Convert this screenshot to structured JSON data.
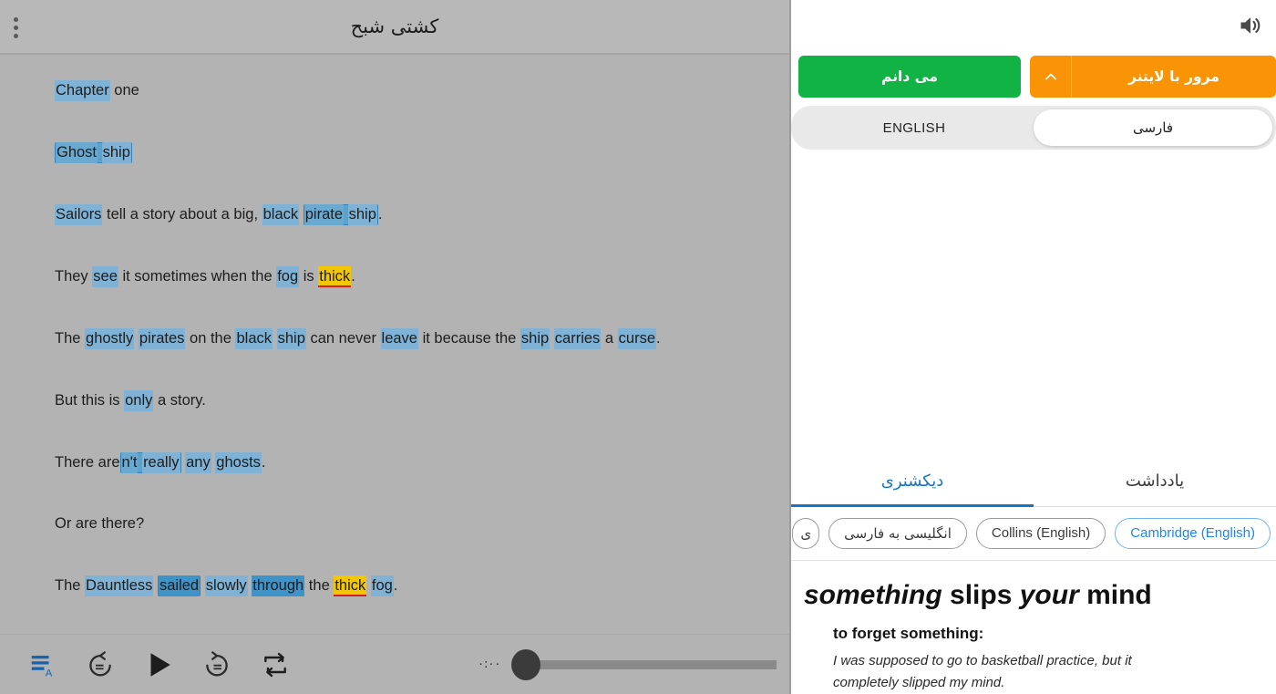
{
  "reader": {
    "menu_icon": "kebab-menu-icon",
    "title": "کشتی شبح",
    "paragraphs": [
      {
        "id": "p1",
        "tokens": [
          {
            "t": "Chapter",
            "hl": "light"
          },
          {
            "t": " one",
            "hl": "none"
          }
        ]
      },
      {
        "id": "p2",
        "tokens": [
          {
            "t": "Ghost ship",
            "hl": "phrase",
            "parts": [
              {
                "t": "Ghost",
                "hl": "mid"
              },
              {
                "t": " ",
                "hl": "none"
              },
              {
                "t": "ship",
                "hl": "light"
              }
            ]
          }
        ]
      },
      {
        "id": "p3",
        "tokens": [
          {
            "t": "Sailors",
            "hl": "light"
          },
          {
            "t": " tell a story about a big, ",
            "hl": "none"
          },
          {
            "t": "black",
            "hl": "light"
          },
          {
            "t": " ",
            "hl": "none"
          },
          {
            "t": "pirate ship",
            "hl": "phrase",
            "parts": [
              {
                "t": "pirate",
                "hl": "mid"
              },
              {
                "t": " ",
                "hl": "none"
              },
              {
                "t": "ship",
                "hl": "light"
              }
            ]
          },
          {
            "t": ".",
            "hl": "none"
          }
        ]
      },
      {
        "id": "p4",
        "tokens": [
          {
            "t": "They ",
            "hl": "none"
          },
          {
            "t": "see",
            "hl": "light"
          },
          {
            "t": " it sometimes when the ",
            "hl": "none"
          },
          {
            "t": "fog",
            "hl": "light"
          },
          {
            "t": " is ",
            "hl": "none"
          },
          {
            "t": "thick",
            "hl": "yellow"
          },
          {
            "t": ".",
            "hl": "none"
          }
        ]
      },
      {
        "id": "p5",
        "tokens": [
          {
            "t": "The ",
            "hl": "none"
          },
          {
            "t": "ghostly",
            "hl": "light"
          },
          {
            "t": " ",
            "hl": "none"
          },
          {
            "t": "pirates",
            "hl": "light"
          },
          {
            "t": " on the ",
            "hl": "none"
          },
          {
            "t": "black",
            "hl": "light"
          },
          {
            "t": " ",
            "hl": "none"
          },
          {
            "t": "ship",
            "hl": "light"
          },
          {
            "t": " can never ",
            "hl": "none"
          },
          {
            "t": "leave",
            "hl": "light"
          },
          {
            "t": " it because the ",
            "hl": "none"
          },
          {
            "t": "ship",
            "hl": "light"
          },
          {
            "t": " ",
            "hl": "none"
          },
          {
            "t": "carries",
            "hl": "light"
          },
          {
            "t": " a ",
            "hl": "none"
          },
          {
            "t": "curse",
            "hl": "light"
          },
          {
            "t": ".",
            "hl": "none"
          }
        ]
      },
      {
        "id": "p6",
        "tokens": [
          {
            "t": "But this is ",
            "hl": "none"
          },
          {
            "t": "only",
            "hl": "light"
          },
          {
            "t": " a story.",
            "hl": "none"
          }
        ]
      },
      {
        "id": "p7",
        "tokens": [
          {
            "t": "There are",
            "hl": "none"
          },
          {
            "t": "n't really",
            "hl": "phrase",
            "parts": [
              {
                "t": "n't",
                "hl": "mid"
              },
              {
                "t": " ",
                "hl": "none"
              },
              {
                "t": "really",
                "hl": "light"
              }
            ]
          },
          {
            "t": " ",
            "hl": "none"
          },
          {
            "t": "any",
            "hl": "light"
          },
          {
            "t": " ",
            "hl": "none"
          },
          {
            "t": "ghosts",
            "hl": "light"
          },
          {
            "t": ".",
            "hl": "none"
          }
        ]
      },
      {
        "id": "p8",
        "tokens": [
          {
            "t": "Or are there?",
            "hl": "none"
          }
        ]
      },
      {
        "id": "p9",
        "tokens": [
          {
            "t": "The ",
            "hl": "none"
          },
          {
            "t": "Dauntless",
            "hl": "light"
          },
          {
            "t": " ",
            "hl": "none"
          },
          {
            "t": "sailed",
            "hl": "phrase",
            "parts": [
              {
                "t": "sailed",
                "hl": "dark"
              }
            ]
          },
          {
            "t": " ",
            "hl": "none"
          },
          {
            "t": "slowly",
            "hl": "light"
          },
          {
            "t": " ",
            "hl": "none"
          },
          {
            "t": "through",
            "hl": "dark"
          },
          {
            "t": " the ",
            "hl": "none"
          },
          {
            "t": "thick",
            "hl": "yellow"
          },
          {
            "t": " ",
            "hl": "none"
          },
          {
            "t": "fog",
            "hl": "light"
          },
          {
            "t": ".",
            "hl": "none"
          }
        ]
      }
    ]
  },
  "player": {
    "text_format_icon": "text-format-icon",
    "rewind_icon": "rewind-5-icon",
    "play_icon": "play-icon",
    "forward_icon": "forward-5-icon",
    "repeat_icon": "repeat-icon",
    "current_time": "۰:۰۰",
    "progress_percent": 0
  },
  "side": {
    "speaker_icon": "speaker-icon",
    "leitner_button": "مرور با لایتنر",
    "leitner_chevron_icon": "chevron-up-icon",
    "know_button": "می دانم",
    "language_segments": [
      {
        "label": "فارسی",
        "active": true
      },
      {
        "label": "ENGLISH",
        "active": false
      }
    ],
    "tabs": [
      {
        "label": "یادداشت",
        "active": false
      },
      {
        "label": "دیکشنری",
        "active": true
      }
    ],
    "dictionary_chips": [
      {
        "label": "Cambridge (English)",
        "active": true
      },
      {
        "label": "Collins (English)",
        "active": false
      },
      {
        "label": "انگلیسی به فارسی",
        "active": false
      },
      {
        "label": "ی",
        "active": false,
        "cut": true
      }
    ],
    "entry": {
      "headword_1": "something",
      "headword_2": "slips",
      "headword_3": "your",
      "headword_4": "mind",
      "sense_definition": "to forget something:",
      "sense_example": "I was supposed to go to basketball practice, but it completely slipped my mind."
    }
  },
  "colors": {
    "reader_bg": "#b3b3b3",
    "highlight_light": "#7fb2d4",
    "highlight_dark": "#3e93c9",
    "highlight_yellow": "#f2c700",
    "underline_red": "#d61f18",
    "orange": "#f89406",
    "green": "#12b345",
    "accent_blue": "#1675c4"
  }
}
